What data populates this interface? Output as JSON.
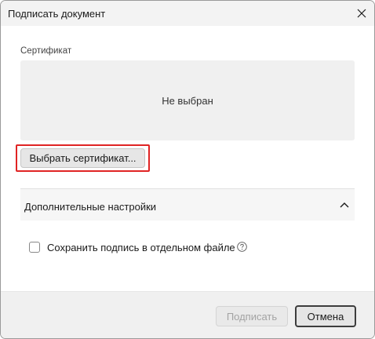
{
  "window": {
    "title": "Подписать документ",
    "close_icon": "close-icon"
  },
  "certificate": {
    "section_label": "Сертификат",
    "status": "Не выбран",
    "select_button_label": "Выбрать сертификат..."
  },
  "advanced": {
    "title": "Дополнительные настройки",
    "expanded": true,
    "chevron_icon": "chevron-up-icon",
    "options": [
      {
        "label": "Сохранить подпись в отдельном файле",
        "checked": false,
        "help_icon": "help-icon"
      }
    ]
  },
  "footer": {
    "sign_button_label": "Подписать",
    "sign_button_enabled": false,
    "cancel_button_label": "Отмена"
  },
  "colors": {
    "highlight_border": "#e02424",
    "disabled_text": "#a3a3a3"
  }
}
